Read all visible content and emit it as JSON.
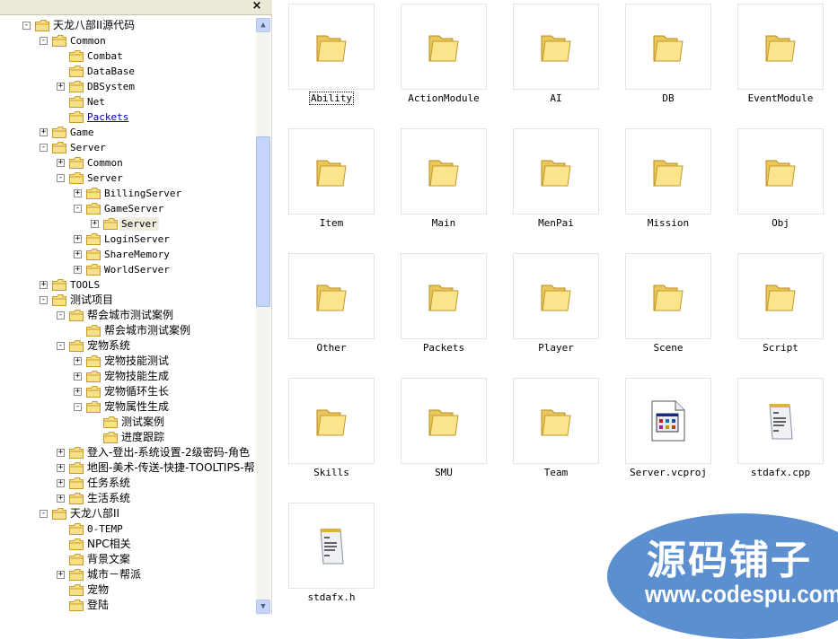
{
  "tree_pane": {
    "close_label": "×",
    "items": [
      {
        "level": 0,
        "exp": "-",
        "label": "天龙八部II源代码"
      },
      {
        "level": 1,
        "exp": "-",
        "label": "Common"
      },
      {
        "level": 2,
        "exp": "",
        "label": "Combat"
      },
      {
        "level": 2,
        "exp": "",
        "label": "DataBase"
      },
      {
        "level": 2,
        "exp": "+",
        "label": "DBSystem"
      },
      {
        "level": 2,
        "exp": "",
        "label": "Net"
      },
      {
        "level": 2,
        "exp": "",
        "label": "Packets",
        "state": "link"
      },
      {
        "level": 1,
        "exp": "+",
        "label": "Game"
      },
      {
        "level": 1,
        "exp": "-",
        "label": "Server"
      },
      {
        "level": 2,
        "exp": "+",
        "label": "Common"
      },
      {
        "level": 2,
        "exp": "-",
        "label": "Server"
      },
      {
        "level": 3,
        "exp": "+",
        "label": "BillingServer"
      },
      {
        "level": 3,
        "exp": "-",
        "label": "GameServer"
      },
      {
        "level": 4,
        "exp": "+",
        "label": "Server",
        "state": "selected"
      },
      {
        "level": 3,
        "exp": "+",
        "label": "LoginServer"
      },
      {
        "level": 3,
        "exp": "+",
        "label": "ShareMemory"
      },
      {
        "level": 3,
        "exp": "+",
        "label": "WorldServer"
      },
      {
        "level": 1,
        "exp": "+",
        "label": "TOOLS"
      },
      {
        "level": 1,
        "exp": "-",
        "label": "测试项目"
      },
      {
        "level": 2,
        "exp": "-",
        "label": "帮会城市测试案例"
      },
      {
        "level": 3,
        "exp": "",
        "label": "帮会城市测试案例"
      },
      {
        "level": 2,
        "exp": "-",
        "label": "宠物系统"
      },
      {
        "level": 3,
        "exp": "+",
        "label": "宠物技能测试"
      },
      {
        "level": 3,
        "exp": "+",
        "label": "宠物技能生成"
      },
      {
        "level": 3,
        "exp": "+",
        "label": "宠物循环生长"
      },
      {
        "level": 3,
        "exp": "-",
        "label": "宠物属性生成"
      },
      {
        "level": 4,
        "exp": "",
        "label": "测试案例"
      },
      {
        "level": 4,
        "exp": "",
        "label": "进度跟踪"
      },
      {
        "level": 2,
        "exp": "+",
        "label": "登入-登出-系统设置-2级密码-角色"
      },
      {
        "level": 2,
        "exp": "+",
        "label": "地图-美术-传送-快捷-TOOLTIPS-帮"
      },
      {
        "level": 2,
        "exp": "+",
        "label": "任务系统"
      },
      {
        "level": 2,
        "exp": "+",
        "label": "生活系统"
      },
      {
        "level": 1,
        "exp": "-",
        "label": "天龙八部II"
      },
      {
        "level": 2,
        "exp": "",
        "label": "0-TEMP"
      },
      {
        "level": 2,
        "exp": "",
        "label": "NPC相关"
      },
      {
        "level": 2,
        "exp": "",
        "label": "背景文案"
      },
      {
        "level": 2,
        "exp": "+",
        "label": "城市－帮派"
      },
      {
        "level": 2,
        "exp": "",
        "label": "宠物"
      },
      {
        "level": 2,
        "exp": "",
        "label": "登陆"
      }
    ]
  },
  "files": [
    {
      "name": "Ability",
      "icon": "folder-icon",
      "focused": true
    },
    {
      "name": "ActionModule",
      "icon": "folder-icon"
    },
    {
      "name": "AI",
      "icon": "folder-icon"
    },
    {
      "name": "DB",
      "icon": "folder-icon"
    },
    {
      "name": "EventModule",
      "icon": "folder-icon"
    },
    {
      "name": "Item",
      "icon": "folder-icon"
    },
    {
      "name": "Main",
      "icon": "folder-icon"
    },
    {
      "name": "MenPai",
      "icon": "folder-icon"
    },
    {
      "name": "Mission",
      "icon": "folder-icon"
    },
    {
      "name": "Obj",
      "icon": "folder-icon"
    },
    {
      "name": "Other",
      "icon": "folder-icon"
    },
    {
      "name": "Packets",
      "icon": "folder-icon"
    },
    {
      "name": "Player",
      "icon": "folder-icon"
    },
    {
      "name": "Scene",
      "icon": "folder-icon"
    },
    {
      "name": "Script",
      "icon": "folder-icon"
    },
    {
      "name": "Skills",
      "icon": "folder-icon"
    },
    {
      "name": "SMU",
      "icon": "folder-icon"
    },
    {
      "name": "Team",
      "icon": "folder-icon"
    },
    {
      "name": "Server.vcproj",
      "icon": "vcproj-file-icon"
    },
    {
      "name": "stdafx.cpp",
      "icon": "notepad-file-icon"
    },
    {
      "name": "stdafx.h",
      "icon": "notepad-file-icon"
    }
  ],
  "watermark": {
    "title": "源码铺子",
    "url": "www.codespu.com"
  }
}
